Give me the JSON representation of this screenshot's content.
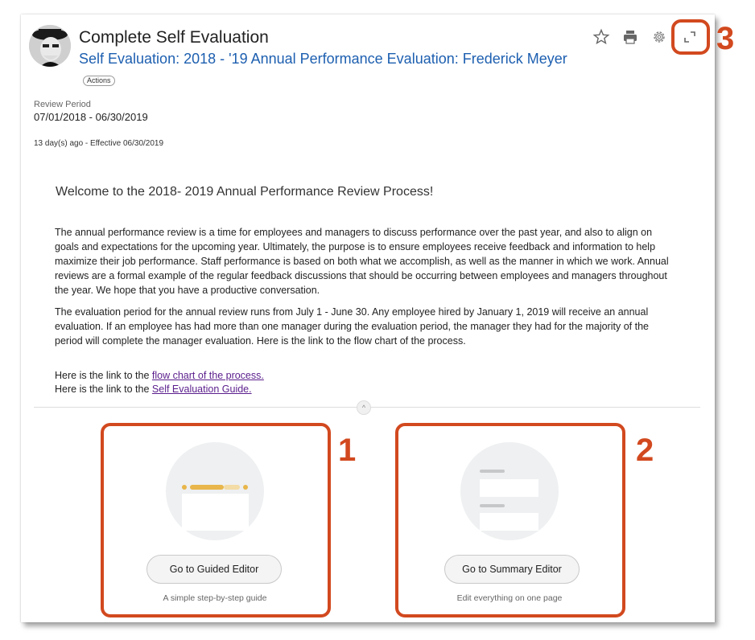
{
  "header": {
    "title": "Complete Self Evaluation",
    "subtitle": "Self Evaluation: 2018 - '19 Annual Performance Evaluation: Frederick Meyer",
    "actions_label": "Actions"
  },
  "toolbar": {
    "icons": [
      "star-icon",
      "print-icon",
      "gear-icon",
      "expand-icon"
    ]
  },
  "review": {
    "period_label": "Review Period",
    "period_value": "07/01/2018 - 06/30/2019",
    "meta": "13 day(s) ago -  Effective 06/30/2019"
  },
  "content": {
    "welcome": "Welcome to the 2018- 2019 Annual Performance Review Process!",
    "paragraph1": "The annual performance review is a time for employees and managers to discuss performance over the past year, and also to align on goals and expectations for the upcoming year. Ultimately, the purpose is to ensure employees receive feedback and information to help maximize their job performance. Staff performance is based on both what we accomplish, as well as the manner in which we work. Annual reviews are a formal example of the regular feedback discussions that should be occurring between employees and managers throughout the year. We hope that you have a productive conversation.",
    "paragraph2": "The evaluation period for the annual review runs from July 1 - June 30. Any employee hired by January 1, 2019 will receive an annual evaluation. If an employee has had more than one manager during the evaluation period, the manager they had for the majority of the period will complete the manager evaluation. Here is the link to the flow chart of the process.",
    "link1_prefix": "Here is the link to the ",
    "link1_text": "flow chart of the process.",
    "link2_prefix": "Here is the link to the ",
    "link2_text": "Self Evaluation Guide."
  },
  "options": [
    {
      "button": "Go to Guided Editor",
      "caption": "A simple step-by-step guide"
    },
    {
      "button": "Go to Summary Editor",
      "caption": "Edit everything on one page"
    }
  ],
  "callouts": [
    "1",
    "2",
    "3"
  ],
  "colors": {
    "accent": "#d2491f",
    "link_blue": "#1d5fb0",
    "link_purple": "#5a1e8c",
    "guided_yellow": "#e8b64a"
  }
}
